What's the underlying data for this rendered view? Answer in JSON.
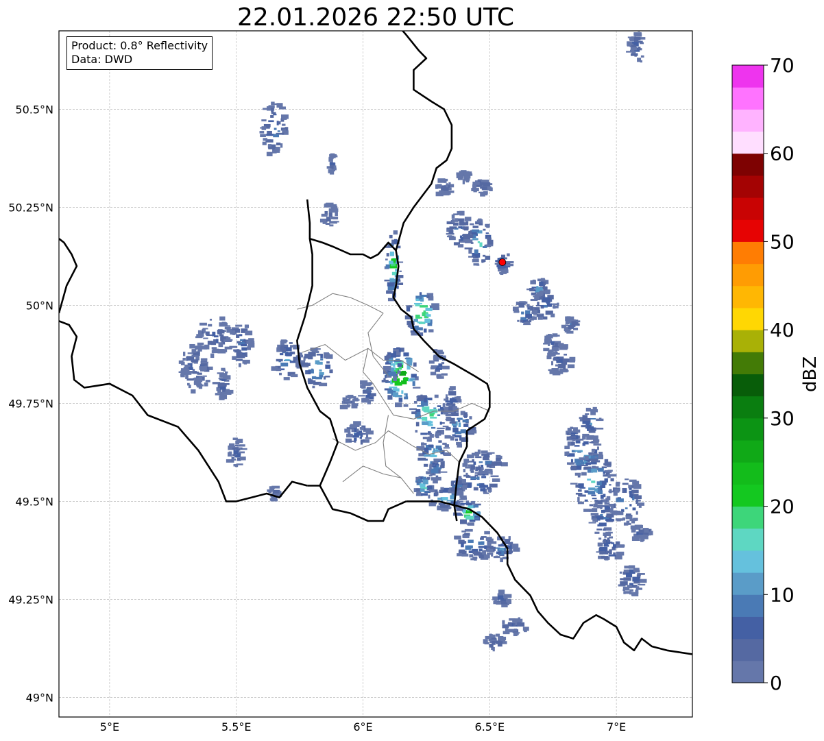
{
  "title": "22.01.2026 22:50 UTC",
  "info": {
    "product_line": "Product: 0.8° Reflectivity",
    "data_line": "Data: DWD"
  },
  "map": {
    "lon_range": [
      4.8,
      7.3
    ],
    "lat_range": [
      48.95,
      50.7
    ],
    "lon_ticks": [
      {
        "value": 5.0,
        "label": "5°E"
      },
      {
        "value": 5.5,
        "label": "5.5°E"
      },
      {
        "value": 6.0,
        "label": "6°E"
      },
      {
        "value": 6.5,
        "label": "6.5°E"
      },
      {
        "value": 7.0,
        "label": "7°E"
      }
    ],
    "lat_ticks": [
      {
        "value": 49.0,
        "label": "49°N"
      },
      {
        "value": 49.25,
        "label": "49.25°N"
      },
      {
        "value": 49.5,
        "label": "49.5°N"
      },
      {
        "value": 49.75,
        "label": "49.75°N"
      },
      {
        "value": 50.0,
        "label": "50°N"
      },
      {
        "value": 50.25,
        "label": "50.25°N"
      },
      {
        "value": 50.5,
        "label": "50.5°N"
      }
    ],
    "gridlines": true,
    "radar_site": {
      "lon": 6.55,
      "lat": 50.11,
      "color": "#ff0000"
    },
    "borders": {
      "national": [
        [
          [
            5.78,
            50.27
          ],
          [
            5.79,
            50.21
          ],
          [
            5.79,
            50.17
          ],
          [
            5.84,
            50.16
          ],
          [
            5.88,
            50.15
          ],
          [
            5.95,
            50.13
          ],
          [
            6.0,
            50.13
          ],
          [
            6.03,
            50.12
          ],
          [
            6.06,
            50.13
          ],
          [
            6.1,
            50.16
          ],
          [
            6.13,
            50.14
          ]
        ],
        [
          [
            6.13,
            50.14
          ],
          [
            6.14,
            50.1
          ],
          [
            6.13,
            50.05
          ],
          [
            6.12,
            50.02
          ],
          [
            6.15,
            49.99
          ],
          [
            6.19,
            49.97
          ],
          [
            6.2,
            49.94
          ],
          [
            6.24,
            49.91
          ],
          [
            6.3,
            49.87
          ],
          [
            6.36,
            49.85
          ],
          [
            6.44,
            49.82
          ],
          [
            6.49,
            49.8
          ],
          [
            6.5,
            49.78
          ],
          [
            6.5,
            49.74
          ],
          [
            6.48,
            49.71
          ],
          [
            6.41,
            49.68
          ],
          [
            6.41,
            49.64
          ],
          [
            6.38,
            49.6
          ],
          [
            6.37,
            49.55
          ],
          [
            6.36,
            49.49
          ],
          [
            6.3,
            49.5
          ],
          [
            6.17,
            49.5
          ]
        ],
        [
          [
            6.17,
            49.5
          ],
          [
            6.1,
            49.48
          ],
          [
            6.08,
            49.45
          ],
          [
            6.02,
            49.45
          ],
          [
            5.95,
            49.47
          ],
          [
            5.88,
            49.48
          ],
          [
            5.83,
            49.54
          ],
          [
            5.87,
            49.6
          ],
          [
            5.9,
            49.65
          ],
          [
            5.87,
            49.71
          ],
          [
            5.83,
            49.73
          ],
          [
            5.78,
            49.79
          ],
          [
            5.75,
            49.85
          ],
          [
            5.74,
            49.91
          ],
          [
            5.77,
            49.97
          ],
          [
            5.8,
            50.05
          ],
          [
            5.8,
            50.13
          ],
          [
            5.79,
            50.17
          ]
        ],
        [
          [
            6.13,
            50.14
          ],
          [
            6.16,
            50.21
          ],
          [
            6.2,
            50.25
          ],
          [
            6.27,
            50.31
          ],
          [
            6.29,
            50.35
          ],
          [
            6.33,
            50.37
          ],
          [
            6.35,
            50.4
          ],
          [
            6.35,
            50.46
          ],
          [
            6.32,
            50.5
          ],
          [
            6.27,
            50.52
          ],
          [
            6.2,
            50.55
          ],
          [
            6.2,
            50.6
          ],
          [
            6.25,
            50.63
          ],
          [
            6.22,
            50.65
          ],
          [
            6.17,
            50.69
          ],
          [
            6.13,
            50.72
          ]
        ],
        [
          [
            6.36,
            49.49
          ],
          [
            6.42,
            49.48
          ],
          [
            6.47,
            49.46
          ],
          [
            6.53,
            49.42
          ],
          [
            6.57,
            49.38
          ],
          [
            6.57,
            49.34
          ],
          [
            6.6,
            49.3
          ],
          [
            6.66,
            49.26
          ],
          [
            6.69,
            49.22
          ],
          [
            6.73,
            49.19
          ],
          [
            6.78,
            49.16
          ],
          [
            6.83,
            49.15
          ],
          [
            6.87,
            49.19
          ],
          [
            6.92,
            49.21
          ],
          [
            6.95,
            49.2
          ],
          [
            7.0,
            49.18
          ],
          [
            7.03,
            49.14
          ],
          [
            7.07,
            49.12
          ],
          [
            7.1,
            49.15
          ],
          [
            7.14,
            49.13
          ],
          [
            7.2,
            49.12
          ],
          [
            7.3,
            49.11
          ]
        ],
        [
          [
            5.78,
            49.54
          ],
          [
            5.72,
            49.55
          ],
          [
            5.67,
            49.51
          ],
          [
            5.62,
            49.52
          ],
          [
            5.56,
            49.51
          ],
          [
            5.5,
            49.5
          ],
          [
            5.46,
            49.5
          ],
          [
            5.43,
            49.55
          ],
          [
            5.35,
            49.63
          ],
          [
            5.31,
            49.66
          ],
          [
            5.27,
            49.69
          ],
          [
            5.15,
            49.72
          ],
          [
            5.09,
            49.77
          ],
          [
            5.0,
            49.8
          ],
          [
            4.9,
            49.79
          ],
          [
            4.86,
            49.81
          ],
          [
            4.85,
            49.87
          ],
          [
            4.87,
            49.92
          ],
          [
            4.84,
            49.95
          ],
          [
            4.8,
            49.96
          ]
        ],
        [
          [
            4.8,
            49.98
          ],
          [
            4.83,
            50.05
          ],
          [
            4.87,
            50.1
          ],
          [
            4.85,
            50.13
          ],
          [
            4.82,
            50.16
          ],
          [
            4.8,
            50.17
          ]
        ],
        [
          [
            5.83,
            49.54
          ],
          [
            5.78,
            49.54
          ]
        ],
        [
          [
            6.36,
            49.49
          ],
          [
            6.37,
            49.45
          ]
        ]
      ],
      "regional": [
        [
          [
            5.74,
            49.99
          ],
          [
            5.8,
            50.0
          ],
          [
            5.88,
            50.03
          ],
          [
            5.95,
            50.02
          ],
          [
            6.02,
            50.0
          ],
          [
            6.08,
            49.98
          ]
        ],
        [
          [
            5.76,
            49.88
          ],
          [
            5.85,
            49.9
          ],
          [
            5.93,
            49.86
          ],
          [
            6.02,
            49.89
          ],
          [
            6.08,
            49.86
          ],
          [
            6.15,
            49.86
          ],
          [
            6.22,
            49.83
          ]
        ],
        [
          [
            6.02,
            49.89
          ],
          [
            6.0,
            49.83
          ],
          [
            6.04,
            49.8
          ],
          [
            6.08,
            49.76
          ],
          [
            6.12,
            49.72
          ],
          [
            6.2,
            49.71
          ],
          [
            6.28,
            49.73
          ],
          [
            6.36,
            49.73
          ],
          [
            6.43,
            49.75
          ],
          [
            6.5,
            49.73
          ]
        ],
        [
          [
            5.88,
            49.66
          ],
          [
            5.97,
            49.63
          ],
          [
            6.05,
            49.65
          ],
          [
            6.1,
            49.68
          ],
          [
            6.2,
            49.64
          ],
          [
            6.26,
            49.62
          ],
          [
            6.33,
            49.63
          ],
          [
            6.38,
            49.6
          ]
        ],
        [
          [
            5.92,
            49.55
          ],
          [
            6.0,
            49.59
          ],
          [
            6.08,
            49.57
          ],
          [
            6.15,
            49.56
          ],
          [
            6.2,
            49.52
          ]
        ],
        [
          [
            6.1,
            49.72
          ],
          [
            6.08,
            49.65
          ],
          [
            6.09,
            49.59
          ],
          [
            6.15,
            49.56
          ]
        ],
        [
          [
            6.08,
            49.98
          ],
          [
            6.02,
            49.93
          ],
          [
            6.04,
            49.87
          ],
          [
            6.1,
            49.82
          ]
        ]
      ]
    },
    "echoes": [
      [
        5.65,
        50.45,
        0.05,
        0.07,
        12
      ],
      [
        5.7,
        49.86,
        0.06,
        0.05,
        14
      ],
      [
        5.82,
        49.84,
        0.06,
        0.05,
        17
      ],
      [
        5.98,
        49.67,
        0.05,
        0.03,
        10
      ],
      [
        5.95,
        49.75,
        0.03,
        0.02,
        8
      ],
      [
        5.42,
        49.92,
        0.07,
        0.05,
        9
      ],
      [
        5.52,
        49.9,
        0.04,
        0.06,
        11
      ],
      [
        5.36,
        49.83,
        0.04,
        0.04,
        10
      ],
      [
        5.33,
        49.84,
        0.05,
        0.06,
        9
      ],
      [
        5.45,
        49.8,
        0.03,
        0.04,
        8
      ],
      [
        5.5,
        49.62,
        0.03,
        0.04,
        9
      ],
      [
        5.65,
        49.52,
        0.02,
        0.02,
        7
      ],
      [
        5.87,
        50.23,
        0.03,
        0.03,
        8
      ],
      [
        5.88,
        50.36,
        0.01,
        0.03,
        7
      ],
      [
        6.12,
        50.1,
        0.03,
        0.09,
        24
      ],
      [
        6.23,
        49.98,
        0.06,
        0.06,
        28
      ],
      [
        6.15,
        49.82,
        0.07,
        0.08,
        31
      ],
      [
        6.12,
        49.85,
        0.03,
        0.04,
        22
      ],
      [
        6.26,
        49.72,
        0.07,
        0.06,
        24
      ],
      [
        6.28,
        49.62,
        0.06,
        0.05,
        18
      ],
      [
        6.38,
        49.69,
        0.06,
        0.05,
        15
      ],
      [
        6.24,
        49.54,
        0.03,
        0.03,
        22
      ],
      [
        6.33,
        49.51,
        0.07,
        0.03,
        19
      ],
      [
        6.42,
        49.47,
        0.05,
        0.03,
        28
      ],
      [
        6.45,
        49.55,
        0.08,
        0.04,
        13
      ],
      [
        6.48,
        49.6,
        0.08,
        0.03,
        11
      ],
      [
        6.44,
        49.39,
        0.08,
        0.04,
        15
      ],
      [
        6.55,
        49.38,
        0.06,
        0.03,
        12
      ],
      [
        6.55,
        49.25,
        0.03,
        0.02,
        10
      ],
      [
        6.6,
        49.18,
        0.06,
        0.02,
        9
      ],
      [
        6.52,
        49.14,
        0.04,
        0.02,
        8
      ],
      [
        6.29,
        49.58,
        0.03,
        0.03,
        14
      ],
      [
        6.37,
        49.54,
        0.04,
        0.02,
        12
      ],
      [
        6.38,
        50.19,
        0.05,
        0.05,
        12
      ],
      [
        6.46,
        50.16,
        0.05,
        0.06,
        18
      ],
      [
        6.55,
        50.11,
        0.03,
        0.03,
        12
      ],
      [
        6.69,
        50.04,
        0.04,
        0.03,
        14
      ],
      [
        6.72,
        50.0,
        0.05,
        0.04,
        12
      ],
      [
        6.64,
        49.98,
        0.04,
        0.03,
        15
      ],
      [
        6.78,
        49.86,
        0.05,
        0.04,
        9
      ],
      [
        6.87,
        49.62,
        0.07,
        0.05,
        18
      ],
      [
        6.91,
        49.55,
        0.08,
        0.08,
        17
      ],
      [
        6.95,
        49.46,
        0.05,
        0.05,
        12
      ],
      [
        7.04,
        49.5,
        0.06,
        0.06,
        14
      ],
      [
        7.1,
        49.42,
        0.04,
        0.02,
        9
      ],
      [
        6.97,
        49.38,
        0.05,
        0.04,
        11
      ],
      [
        7.06,
        49.3,
        0.05,
        0.04,
        10
      ],
      [
        6.9,
        49.7,
        0.04,
        0.04,
        12
      ],
      [
        6.83,
        49.67,
        0.02,
        0.02,
        10
      ],
      [
        6.75,
        49.9,
        0.03,
        0.03,
        8
      ],
      [
        6.82,
        49.95,
        0.03,
        0.02,
        9
      ],
      [
        6.32,
        50.3,
        0.03,
        0.02,
        8
      ],
      [
        6.47,
        50.3,
        0.04,
        0.02,
        7
      ],
      [
        7.08,
        50.66,
        0.03,
        0.05,
        8
      ],
      [
        6.4,
        50.33,
        0.02,
        0.02,
        7
      ],
      [
        6.02,
        49.78,
        0.03,
        0.03,
        10
      ],
      [
        6.3,
        49.85,
        0.03,
        0.04,
        10
      ],
      [
        6.35,
        49.76,
        0.03,
        0.03,
        12
      ]
    ]
  },
  "colorbar": {
    "label": "dBZ",
    "min": 0,
    "max": 70,
    "ticks": [
      0,
      10,
      20,
      30,
      40,
      50,
      60,
      70
    ],
    "step": 2.5,
    "colors": [
      "#6577aa",
      "#5569a2",
      "#4460a4",
      "#4a7ab5",
      "#5a9cc8",
      "#65c1dd",
      "#5ed7c2",
      "#3dd67a",
      "#14c820",
      "#13bc1b",
      "#10a917",
      "#0c9414",
      "#0a7e10",
      "#085d09",
      "#437b06",
      "#a9b106",
      "#ffd703",
      "#ffb703",
      "#ff9c03",
      "#ff7d03",
      "#e60303",
      "#c90303",
      "#a40303",
      "#7e0202",
      "#ffdeff",
      "#ffb3ff",
      "#ff73ff",
      "#ee34ee"
    ]
  }
}
